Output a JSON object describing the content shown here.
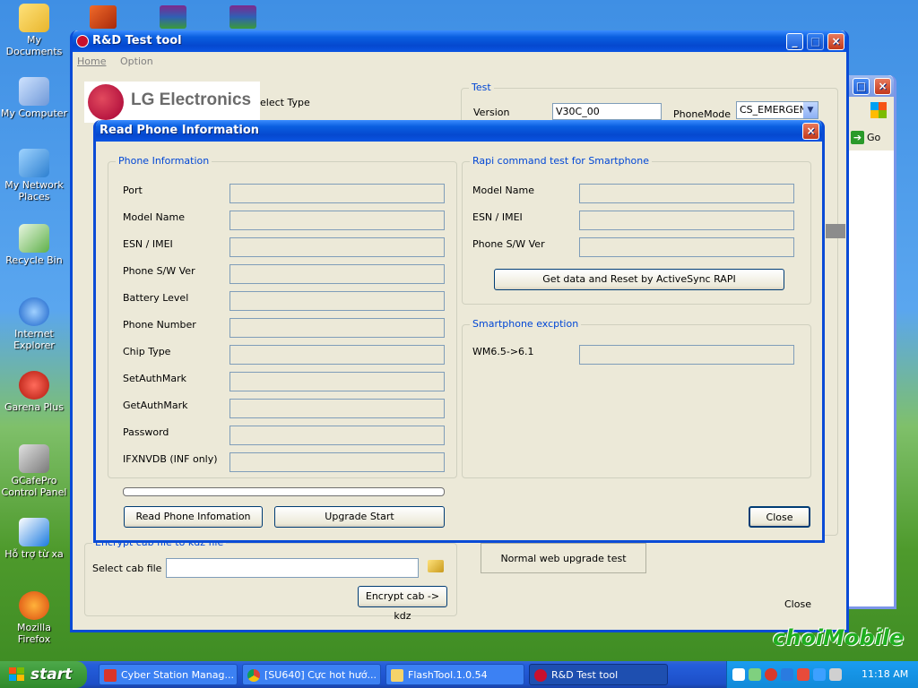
{
  "desktop": {
    "icons": [
      {
        "label": "My Documents"
      },
      {
        "label": "My Computer"
      },
      {
        "label": "My Network Places"
      },
      {
        "label": "Recycle Bin"
      },
      {
        "label": "Internet Explorer"
      },
      {
        "label": "Garena Plus"
      },
      {
        "label": "GCafePro Control Panel"
      },
      {
        "label": "Hỗ trợ từ xa"
      },
      {
        "label": "Mozilla Firefox"
      }
    ],
    "watermark": "choiMobile"
  },
  "main_window": {
    "title": "R&D Test tool",
    "menu": {
      "home": "Home",
      "option": "Option"
    },
    "logo_text": "LG Electronics",
    "select_type_label": "elect Type",
    "test_group": {
      "label": "Test",
      "version_label": "Version",
      "version_value": "V30C_00",
      "phonemode_label": "PhoneMode",
      "phonemode_value": "CS_EMERGEN"
    },
    "encrypt_group": {
      "label": "Encrypt cab file to kdz file",
      "select_cab_label": "Select cab file",
      "select_cab_value": "",
      "encrypt_button": "Encrypt cab -> kdz"
    },
    "normal_web_upgrade": "Normal web upgrade test",
    "close_label": "Close"
  },
  "browser_window": {
    "go_label": "Go"
  },
  "dialog": {
    "title": "Read Phone Information",
    "phone_info": {
      "label": "Phone Information",
      "fields": [
        {
          "label": "Port",
          "value": ""
        },
        {
          "label": "Model Name",
          "value": ""
        },
        {
          "label": "ESN / IMEI",
          "value": ""
        },
        {
          "label": "Phone S/W Ver",
          "value": ""
        },
        {
          "label": "Battery Level",
          "value": ""
        },
        {
          "label": "Phone Number",
          "value": ""
        },
        {
          "label": "Chip Type",
          "value": ""
        },
        {
          "label": "SetAuthMark",
          "value": ""
        },
        {
          "label": "GetAuthMark",
          "value": ""
        },
        {
          "label": "Password",
          "value": ""
        },
        {
          "label": "IFXNVDB (INF only)",
          "value": ""
        }
      ]
    },
    "progress": 0,
    "rapi": {
      "label": "Rapi command test for Smartphone",
      "fields": [
        {
          "label": "Model Name",
          "value": ""
        },
        {
          "label": "ESN / IMEI",
          "value": ""
        },
        {
          "label": "Phone S/W Ver",
          "value": ""
        }
      ],
      "button": "Get data and Reset by ActiveSync RAPI"
    },
    "smartphone_exception": {
      "label": "Smartphone excption",
      "field_label": "WM6.5->6.1",
      "field_value": ""
    },
    "buttons": {
      "read": "Read Phone Infomation",
      "upgrade": "Upgrade Start",
      "close": "Close"
    }
  },
  "taskbar": {
    "start": "start",
    "tasks": [
      {
        "label": "Cyber Station Manag..."
      },
      {
        "label": "[SU640] Cực hot hướ..."
      },
      {
        "label": "FlashTool.1.0.54"
      },
      {
        "label": "R&D Test tool"
      }
    ],
    "clock": "11:18 AM"
  }
}
